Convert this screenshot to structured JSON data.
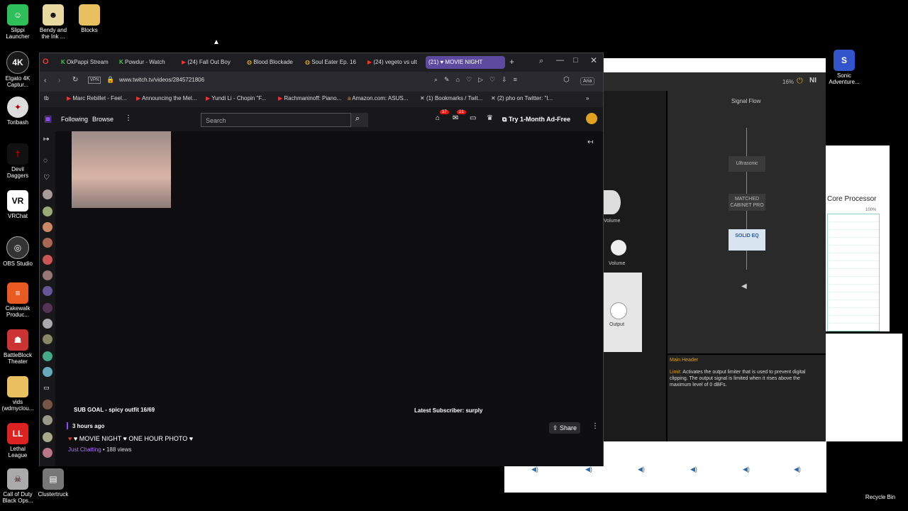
{
  "desktop": {
    "icons": [
      {
        "label": "Slippi Launcher",
        "name": "slippi-launcher-icon",
        "color": "#2fbf5a"
      },
      {
        "label": "Bendy and the Ink ...",
        "name": "bendy-icon",
        "color": "#e8d9a0"
      },
      {
        "label": "Blocks",
        "name": "blocks-folder-icon",
        "color": "#e8c060"
      },
      {
        "label": "Elgato 4K Captur...",
        "name": "elgato-icon",
        "color": "#1a1a1a"
      },
      {
        "label": "Toribash",
        "name": "toribash-icon",
        "color": "#ddd"
      },
      {
        "label": "Devil Daggers",
        "name": "devil-daggers-icon",
        "color": "#111"
      },
      {
        "label": "VRChat",
        "name": "vrchat-icon",
        "color": "#fff"
      },
      {
        "label": "OBS Studio",
        "name": "obs-icon",
        "color": "#333"
      },
      {
        "label": "Cakewalk Produc...",
        "name": "cakewalk-icon",
        "color": "#e85a20"
      },
      {
        "label": "BattleBlock Theater",
        "name": "battleblock-icon",
        "color": "#c33"
      },
      {
        "label": "vids (wdmyclou...",
        "name": "vids-folder-icon",
        "color": "#e8c060"
      },
      {
        "label": "Lethal League",
        "name": "lethal-league-icon",
        "color": "#d22"
      },
      {
        "label": "Call of Duty Black Ops...",
        "name": "call-of-duty-icon",
        "color": "#aaa"
      },
      {
        "label": "Clustertruck",
        "name": "clustertruck-icon",
        "color": "#777"
      },
      {
        "label": "Sonic Adventure...",
        "name": "sonic-icon",
        "color": "#3355cc"
      },
      {
        "label": "Recycle Bin",
        "name": "recycle-bin-icon",
        "color": "#000"
      }
    ]
  },
  "browser": {
    "tabs": [
      {
        "label": "OkPappi Stream"
      },
      {
        "label": "Powdur - Watch"
      },
      {
        "label": "(24) Fall Out Boy"
      },
      {
        "label": "Blood Blockade"
      },
      {
        "label": "Soul Eater Ep. 16"
      },
      {
        "label": "(24) vegeto vs ult"
      },
      {
        "label": "(21) ♥ MOVIE NIGHT"
      }
    ],
    "url": "www.twitch.tv/videos/2845721806",
    "vpn": "VPN",
    "ai": "Aria",
    "bookmarks": [
      {
        "label": "tb"
      },
      {
        "label": "Marc Rebillet - Feel..."
      },
      {
        "label": "Announcing the Mel..."
      },
      {
        "label": "Yundi Li - Chopin \"F..."
      },
      {
        "label": "Rachmaninoff: Piano..."
      },
      {
        "label": "Amazon.com: ASUS..."
      },
      {
        "label": "(1) Bookmarks / Twit..."
      },
      {
        "label": "(2) pho on Twitter: \"I..."
      }
    ]
  },
  "twitch": {
    "nav": {
      "following": "Following",
      "browse": "Browse",
      "search_placeholder": "Search",
      "notif_count": "37",
      "whisper_count": "21",
      "try_ad_free": "Try 1-Month Ad-Free"
    },
    "overlay": {
      "sub_goal": "SUB GOAL - spicy outfit 16/69",
      "latest_sub": "Latest Subscriber: surply"
    },
    "video": {
      "time_ago": "3 hours ago",
      "title": "♥ MOVIE NIGHT ♥ ONE HOUR PHOTO ♥",
      "category": "Just Chatting",
      "views": " • 188 views",
      "share": "Share"
    }
  },
  "guitar_rig": {
    "zoom": "16%",
    "signal_flow": "Signal Flow",
    "modules": [
      "Ultrasonic",
      "MATCHED CABINET PRO",
      "SOLID EQ"
    ],
    "volume_label": "Volume",
    "volume_label2": "Volume",
    "output_label": "Output",
    "help_title": "Main Header",
    "help_term": "Limit:",
    "help_text": " Activates the output limiter that is used to prevent digital clipping. The output signal is limited when it rises above the maximum level of 0 dBFs."
  },
  "core_processor": {
    "title": "Core Processor",
    "pct": "100%"
  }
}
